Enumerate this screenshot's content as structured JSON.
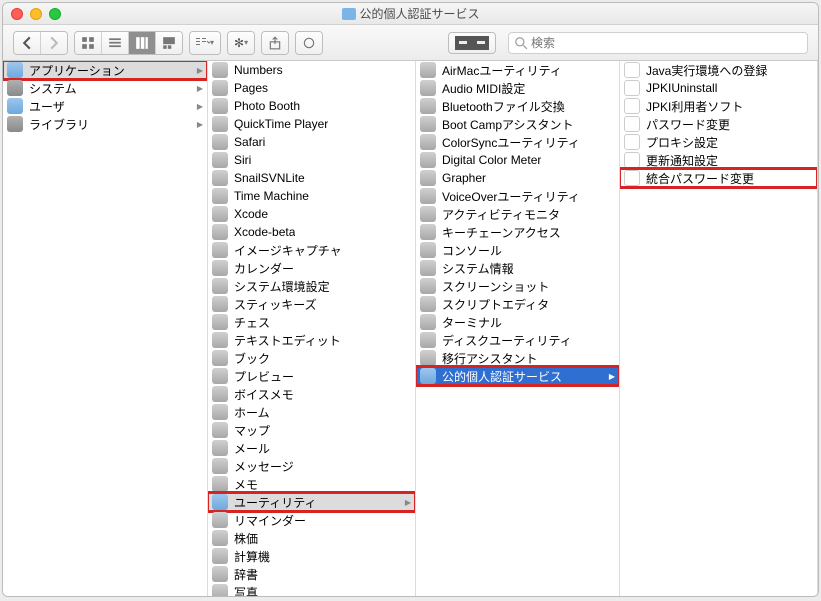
{
  "window": {
    "title": "公的個人認証サービス"
  },
  "search": {
    "placeholder": "検索"
  },
  "highlights": {
    "col1_index": 0,
    "col2_index": 28,
    "col3_index": 17,
    "col4_index": 5
  },
  "col1": [
    {
      "label": "アプリケーション",
      "icon": "folder",
      "selected": true,
      "hasChildren": true
    },
    {
      "label": "システム",
      "icon": "folder-sys",
      "hasChildren": true
    },
    {
      "label": "ユーザ",
      "icon": "folder",
      "hasChildren": true
    },
    {
      "label": "ライブラリ",
      "icon": "folder-sys",
      "hasChildren": true
    }
  ],
  "col2": [
    {
      "label": "Numbers",
      "icon": "app"
    },
    {
      "label": "Pages",
      "icon": "app"
    },
    {
      "label": "Photo Booth",
      "icon": "app"
    },
    {
      "label": "QuickTime Player",
      "icon": "app"
    },
    {
      "label": "Safari",
      "icon": "app"
    },
    {
      "label": "Siri",
      "icon": "app"
    },
    {
      "label": "SnailSVNLite",
      "icon": "app"
    },
    {
      "label": "Time Machine",
      "icon": "app"
    },
    {
      "label": "Xcode",
      "icon": "app"
    },
    {
      "label": "Xcode-beta",
      "icon": "app"
    },
    {
      "label": "イメージキャプチャ",
      "icon": "app"
    },
    {
      "label": "カレンダー",
      "icon": "app"
    },
    {
      "label": "システム環境設定",
      "icon": "app"
    },
    {
      "label": "スティッキーズ",
      "icon": "app"
    },
    {
      "label": "チェス",
      "icon": "app"
    },
    {
      "label": "テキストエディット",
      "icon": "app"
    },
    {
      "label": "ブック",
      "icon": "app"
    },
    {
      "label": "プレビュー",
      "icon": "app"
    },
    {
      "label": "ボイスメモ",
      "icon": "app"
    },
    {
      "label": "ホーム",
      "icon": "app"
    },
    {
      "label": "マップ",
      "icon": "app"
    },
    {
      "label": "メール",
      "icon": "app"
    },
    {
      "label": "メッセージ",
      "icon": "app"
    },
    {
      "label": "メモ",
      "icon": "app"
    },
    {
      "label": "ユーティリティ",
      "icon": "folder",
      "selected": true,
      "hasChildren": true
    },
    {
      "label": "リマインダー",
      "icon": "app"
    },
    {
      "label": "株価",
      "icon": "app"
    },
    {
      "label": "計算機",
      "icon": "app"
    },
    {
      "label": "辞書",
      "icon": "app"
    },
    {
      "label": "写真",
      "icon": "app"
    }
  ],
  "col3": [
    {
      "label": "AirMacユーティリティ",
      "icon": "app"
    },
    {
      "label": "Audio MIDI設定",
      "icon": "app"
    },
    {
      "label": "Bluetoothファイル交換",
      "icon": "app"
    },
    {
      "label": "Boot Campアシスタント",
      "icon": "app"
    },
    {
      "label": "ColorSyncユーティリティ",
      "icon": "app"
    },
    {
      "label": "Digital Color Meter",
      "icon": "app"
    },
    {
      "label": "Grapher",
      "icon": "app"
    },
    {
      "label": "VoiceOverユーティリティ",
      "icon": "app"
    },
    {
      "label": "アクティビティモニタ",
      "icon": "app"
    },
    {
      "label": "キーチェーンアクセス",
      "icon": "app"
    },
    {
      "label": "コンソール",
      "icon": "app"
    },
    {
      "label": "システム情報",
      "icon": "app"
    },
    {
      "label": "スクリーンショット",
      "icon": "app"
    },
    {
      "label": "スクリプトエディタ",
      "icon": "app"
    },
    {
      "label": "ターミナル",
      "icon": "app"
    },
    {
      "label": "ディスクユーティリティ",
      "icon": "app"
    },
    {
      "label": "移行アシスタント",
      "icon": "app"
    },
    {
      "label": "公的個人認証サービス",
      "icon": "folder",
      "blue": true,
      "hasChildren": true
    }
  ],
  "col4": [
    {
      "label": "Java実行環境への登録",
      "icon": "doc"
    },
    {
      "label": "JPKIUninstall",
      "icon": "doc"
    },
    {
      "label": "JPKI利用者ソフト",
      "icon": "doc"
    },
    {
      "label": "パスワード変更",
      "icon": "doc"
    },
    {
      "label": "プロキシ設定",
      "icon": "doc"
    },
    {
      "label": "更新通知設定",
      "icon": "doc"
    },
    {
      "label": "統合パスワード変更",
      "icon": "doc"
    }
  ]
}
